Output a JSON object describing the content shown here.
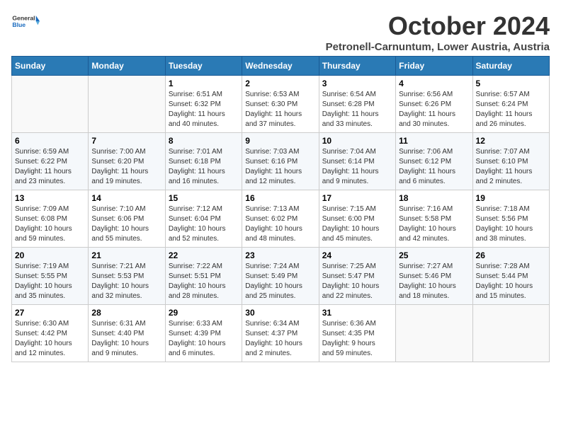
{
  "header": {
    "logo_general": "General",
    "logo_blue": "Blue",
    "month": "October 2024",
    "location": "Petronell-Carnuntum, Lower Austria, Austria"
  },
  "calendar": {
    "days_of_week": [
      "Sunday",
      "Monday",
      "Tuesday",
      "Wednesday",
      "Thursday",
      "Friday",
      "Saturday"
    ],
    "weeks": [
      [
        {
          "day": "",
          "info": ""
        },
        {
          "day": "",
          "info": ""
        },
        {
          "day": "1",
          "info": "Sunrise: 6:51 AM\nSunset: 6:32 PM\nDaylight: 11 hours\nand 40 minutes."
        },
        {
          "day": "2",
          "info": "Sunrise: 6:53 AM\nSunset: 6:30 PM\nDaylight: 11 hours\nand 37 minutes."
        },
        {
          "day": "3",
          "info": "Sunrise: 6:54 AM\nSunset: 6:28 PM\nDaylight: 11 hours\nand 33 minutes."
        },
        {
          "day": "4",
          "info": "Sunrise: 6:56 AM\nSunset: 6:26 PM\nDaylight: 11 hours\nand 30 minutes."
        },
        {
          "day": "5",
          "info": "Sunrise: 6:57 AM\nSunset: 6:24 PM\nDaylight: 11 hours\nand 26 minutes."
        }
      ],
      [
        {
          "day": "6",
          "info": "Sunrise: 6:59 AM\nSunset: 6:22 PM\nDaylight: 11 hours\nand 23 minutes."
        },
        {
          "day": "7",
          "info": "Sunrise: 7:00 AM\nSunset: 6:20 PM\nDaylight: 11 hours\nand 19 minutes."
        },
        {
          "day": "8",
          "info": "Sunrise: 7:01 AM\nSunset: 6:18 PM\nDaylight: 11 hours\nand 16 minutes."
        },
        {
          "day": "9",
          "info": "Sunrise: 7:03 AM\nSunset: 6:16 PM\nDaylight: 11 hours\nand 12 minutes."
        },
        {
          "day": "10",
          "info": "Sunrise: 7:04 AM\nSunset: 6:14 PM\nDaylight: 11 hours\nand 9 minutes."
        },
        {
          "day": "11",
          "info": "Sunrise: 7:06 AM\nSunset: 6:12 PM\nDaylight: 11 hours\nand 6 minutes."
        },
        {
          "day": "12",
          "info": "Sunrise: 7:07 AM\nSunset: 6:10 PM\nDaylight: 11 hours\nand 2 minutes."
        }
      ],
      [
        {
          "day": "13",
          "info": "Sunrise: 7:09 AM\nSunset: 6:08 PM\nDaylight: 10 hours\nand 59 minutes."
        },
        {
          "day": "14",
          "info": "Sunrise: 7:10 AM\nSunset: 6:06 PM\nDaylight: 10 hours\nand 55 minutes."
        },
        {
          "day": "15",
          "info": "Sunrise: 7:12 AM\nSunset: 6:04 PM\nDaylight: 10 hours\nand 52 minutes."
        },
        {
          "day": "16",
          "info": "Sunrise: 7:13 AM\nSunset: 6:02 PM\nDaylight: 10 hours\nand 48 minutes."
        },
        {
          "day": "17",
          "info": "Sunrise: 7:15 AM\nSunset: 6:00 PM\nDaylight: 10 hours\nand 45 minutes."
        },
        {
          "day": "18",
          "info": "Sunrise: 7:16 AM\nSunset: 5:58 PM\nDaylight: 10 hours\nand 42 minutes."
        },
        {
          "day": "19",
          "info": "Sunrise: 7:18 AM\nSunset: 5:56 PM\nDaylight: 10 hours\nand 38 minutes."
        }
      ],
      [
        {
          "day": "20",
          "info": "Sunrise: 7:19 AM\nSunset: 5:55 PM\nDaylight: 10 hours\nand 35 minutes."
        },
        {
          "day": "21",
          "info": "Sunrise: 7:21 AM\nSunset: 5:53 PM\nDaylight: 10 hours\nand 32 minutes."
        },
        {
          "day": "22",
          "info": "Sunrise: 7:22 AM\nSunset: 5:51 PM\nDaylight: 10 hours\nand 28 minutes."
        },
        {
          "day": "23",
          "info": "Sunrise: 7:24 AM\nSunset: 5:49 PM\nDaylight: 10 hours\nand 25 minutes."
        },
        {
          "day": "24",
          "info": "Sunrise: 7:25 AM\nSunset: 5:47 PM\nDaylight: 10 hours\nand 22 minutes."
        },
        {
          "day": "25",
          "info": "Sunrise: 7:27 AM\nSunset: 5:46 PM\nDaylight: 10 hours\nand 18 minutes."
        },
        {
          "day": "26",
          "info": "Sunrise: 7:28 AM\nSunset: 5:44 PM\nDaylight: 10 hours\nand 15 minutes."
        }
      ],
      [
        {
          "day": "27",
          "info": "Sunrise: 6:30 AM\nSunset: 4:42 PM\nDaylight: 10 hours\nand 12 minutes."
        },
        {
          "day": "28",
          "info": "Sunrise: 6:31 AM\nSunset: 4:40 PM\nDaylight: 10 hours\nand 9 minutes."
        },
        {
          "day": "29",
          "info": "Sunrise: 6:33 AM\nSunset: 4:39 PM\nDaylight: 10 hours\nand 6 minutes."
        },
        {
          "day": "30",
          "info": "Sunrise: 6:34 AM\nSunset: 4:37 PM\nDaylight: 10 hours\nand 2 minutes."
        },
        {
          "day": "31",
          "info": "Sunrise: 6:36 AM\nSunset: 4:35 PM\nDaylight: 9 hours\nand 59 minutes."
        },
        {
          "day": "",
          "info": ""
        },
        {
          "day": "",
          "info": ""
        }
      ]
    ]
  }
}
